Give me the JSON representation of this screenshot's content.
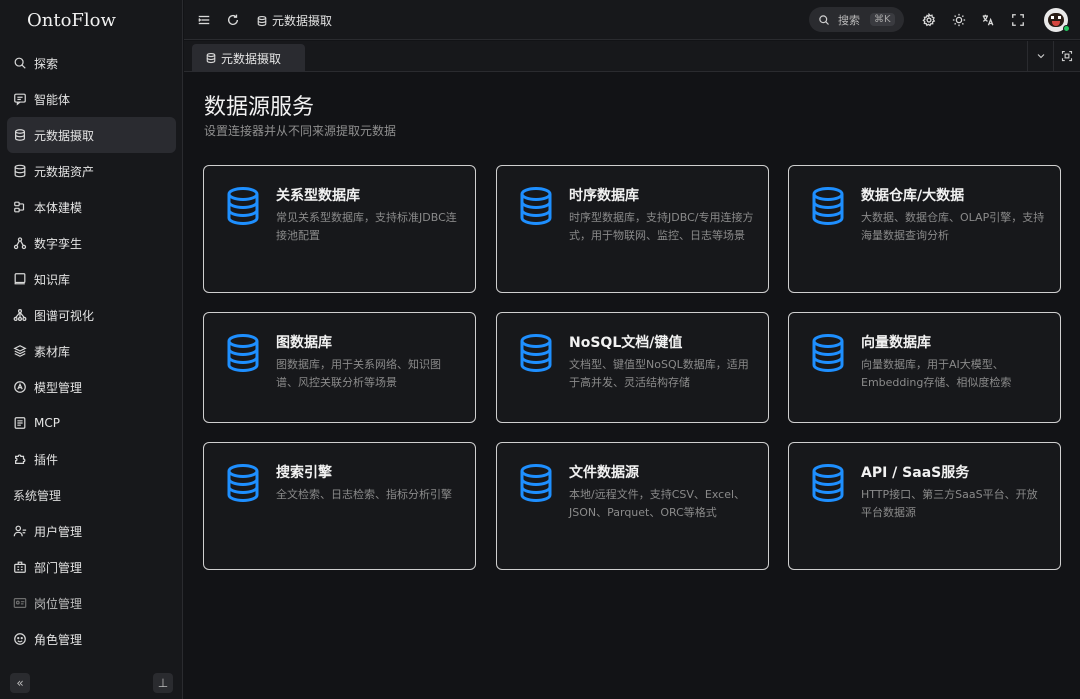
{
  "brand": "OntoFlow",
  "sidebar": {
    "items": [
      {
        "label": "探索",
        "icon": "search-icon"
      },
      {
        "label": "智能体",
        "icon": "chat-icon"
      },
      {
        "label": "元数据摄取",
        "icon": "database-stack-icon",
        "active": true
      },
      {
        "label": "元数据资产",
        "icon": "database-icon"
      },
      {
        "label": "本体建模",
        "icon": "model-icon"
      },
      {
        "label": "数字孪生",
        "icon": "network-icon"
      },
      {
        "label": "知识库",
        "icon": "book-icon"
      },
      {
        "label": "图谱可视化",
        "icon": "graph-icon"
      },
      {
        "label": "素材库",
        "icon": "layers-icon"
      },
      {
        "label": "模型管理",
        "icon": "ai-model-icon"
      },
      {
        "label": "MCP",
        "icon": "mcp-icon"
      },
      {
        "label": "插件",
        "icon": "puzzle-icon"
      }
    ],
    "section_title": "系统管理",
    "admin_items": [
      {
        "label": "用户管理",
        "icon": "user-icon"
      },
      {
        "label": "部门管理",
        "icon": "building-icon"
      },
      {
        "label": "岗位管理",
        "icon": "id-card-icon"
      },
      {
        "label": "角色管理",
        "icon": "role-icon"
      }
    ],
    "collapse_glyph": "«",
    "pin_glyph": "⊥"
  },
  "topbar": {
    "breadcrumb": "元数据摄取",
    "search_label": "搜索",
    "search_shortcut": "⌘K"
  },
  "tabs": [
    {
      "label": "元数据摄取",
      "active": true
    }
  ],
  "main": {
    "title": "数据源服务",
    "subtitle": "设置连接器并从不同来源提取元数据",
    "cards": [
      {
        "title": "关系型数据库",
        "desc": "常见关系型数据库，支持标准JDBC连接池配置"
      },
      {
        "title": "时序数据库",
        "desc": "时序型数据库，支持JDBC/专用连接方式，用于物联网、监控、日志等场景"
      },
      {
        "title": "数据仓库/大数据",
        "desc": "大数据、数据仓库、OLAP引擎，支持海量数据查询分析"
      },
      {
        "title": "图数据库",
        "desc": "图数据库，用于关系网络、知识图谱、风控关联分析等场景"
      },
      {
        "title": "NoSQL文档/键值",
        "desc": "文档型、键值型NoSQL数据库，适用于高并发、灵活结构存储"
      },
      {
        "title": "向量数据库",
        "desc": "向量数据库，用于AI大模型、Embedding存储、相似度检索"
      },
      {
        "title": "搜索引擎",
        "desc": "全文检索、日志检索、指标分析引擎"
      },
      {
        "title": "文件数据源",
        "desc": "本地/远程文件，支持CSV、Excel、JSON、Parquet、ORC等格式"
      },
      {
        "title": "API / SaaS服务",
        "desc": "HTTP接口、第三方SaaS平台、开放平台数据源"
      }
    ]
  },
  "colors": {
    "accent": "#1e8fff",
    "background": "#121316",
    "sidebar": "#17181b",
    "online": "#22c55e"
  }
}
